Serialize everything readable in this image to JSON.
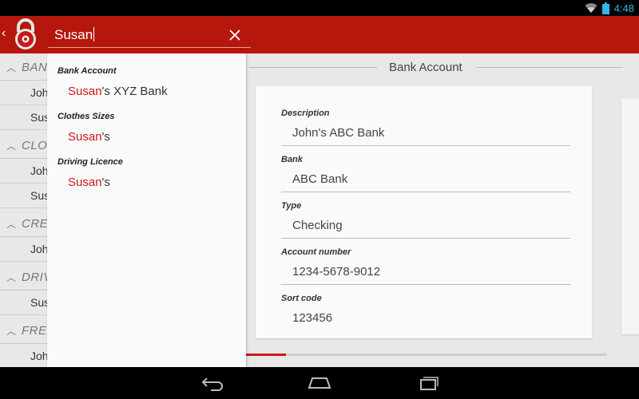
{
  "status_bar": {
    "time": "4:48",
    "icons": [
      "wifi-icon",
      "battery-icon"
    ],
    "time_color": "#33b5e5"
  },
  "action_bar": {
    "color": "#b5170d",
    "app_icon": "padlock-icon",
    "search": {
      "value": "Susan",
      "clear_icon": "close-icon"
    }
  },
  "list": {
    "sections": [
      {
        "label": "BANK",
        "items": [
          "John",
          "Susan"
        ]
      },
      {
        "label": "CLOTHES SIZES",
        "items": [
          "John",
          "Susan"
        ]
      },
      {
        "label": "CREDIT CARD",
        "items": [
          "John"
        ]
      },
      {
        "label": "DRIVING LICENCE",
        "items": [
          "Susan"
        ]
      },
      {
        "label": "FREQUENT FLYER",
        "items": [
          "John"
        ]
      }
    ]
  },
  "suggestions": {
    "groups": [
      {
        "title": "Bank Account",
        "items": [
          {
            "match": "Susan",
            "rest": "'s XYZ Bank"
          }
        ]
      },
      {
        "title": "Clothes Sizes",
        "items": [
          {
            "match": "Susan",
            "rest": "'s"
          }
        ]
      },
      {
        "title": "Driving Licence",
        "items": [
          {
            "match": "Susan",
            "rest": "'s"
          }
        ]
      }
    ],
    "highlight_color": "#d3141a"
  },
  "detail": {
    "title": "Bank Account",
    "fields": [
      {
        "label": "Description",
        "value": "John's ABC Bank"
      },
      {
        "label": "Bank",
        "value": "ABC Bank"
      },
      {
        "label": "Type",
        "value": "Checking"
      },
      {
        "label": "Account number",
        "value": "1234-5678-9012"
      },
      {
        "label": "Sort code",
        "value": "123456"
      }
    ],
    "pager_progress": 0.11
  },
  "nav_bar": {
    "buttons": [
      "back-icon",
      "home-icon",
      "recent-apps-icon"
    ]
  }
}
